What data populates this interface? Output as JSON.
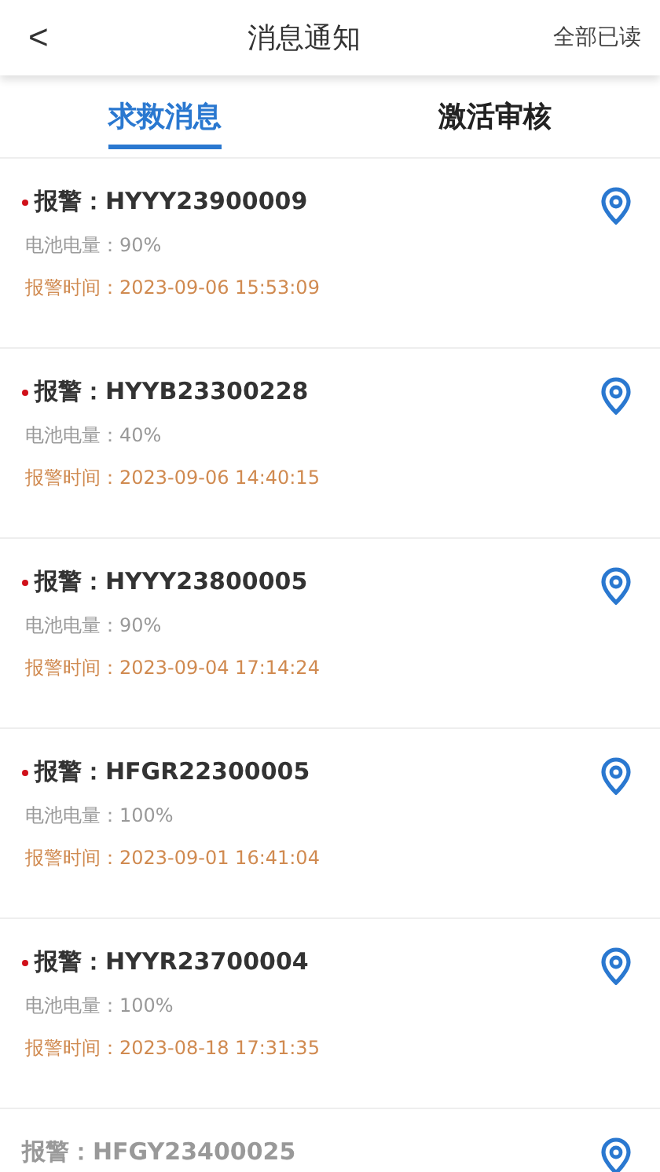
{
  "header": {
    "back": "<",
    "title": "消息通知",
    "action": "全部已读"
  },
  "tabs": [
    {
      "label": "求救消息",
      "selected": true
    },
    {
      "label": "激活审核",
      "selected": false
    }
  ],
  "alerts": [
    {
      "title": "报警：HYYY23900009",
      "unread": true,
      "battery": "电池电量：90%",
      "time": "报警时间：2023-09-06 15:53:09"
    },
    {
      "title": "报警：HYYB23300228",
      "unread": true,
      "battery": "电池电量：40%",
      "time": "报警时间：2023-09-06 14:40:15"
    },
    {
      "title": "报警：HYYY23800005",
      "unread": true,
      "battery": "电池电量：90%",
      "time": "报警时间：2023-09-04 17:14:24"
    },
    {
      "title": "报警：HFGR22300005",
      "unread": true,
      "battery": "电池电量：100%",
      "time": "报警时间：2023-09-01 16:41:04"
    },
    {
      "title": "报警：HYYR23700004",
      "unread": true,
      "battery": "电池电量：100%",
      "time": "报警时间：2023-08-18 17:31:35"
    },
    {
      "title": "报警：HFGY23400025",
      "unread": false
    }
  ]
}
